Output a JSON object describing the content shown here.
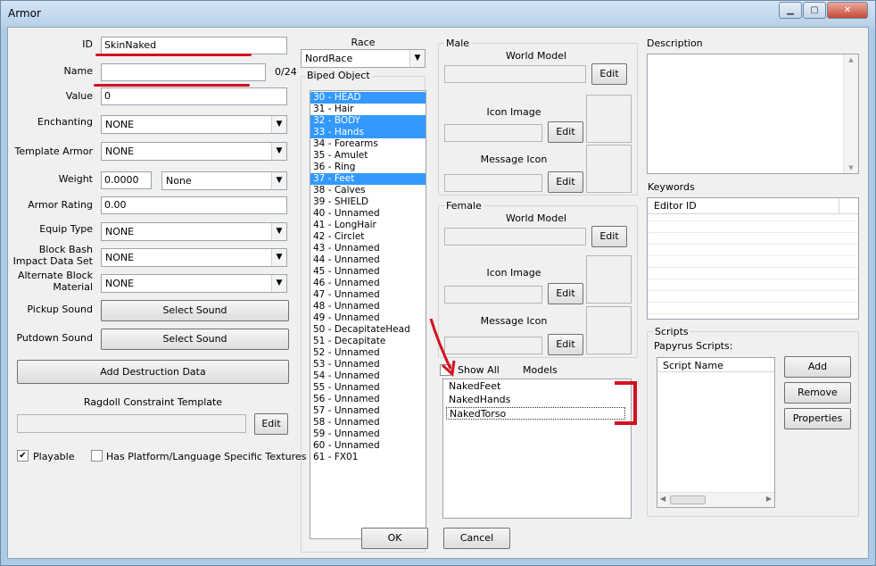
{
  "window": {
    "title": "Armor"
  },
  "form": {
    "id_label": "ID",
    "id_value": "SkinNaked",
    "name_label": "Name",
    "name_value": "",
    "name_counter": "0/24",
    "value_label": "Value",
    "value_value": "0",
    "enchanting_label": "Enchanting",
    "enchanting_value": "NONE",
    "template_label": "Template Armor",
    "template_value": "NONE",
    "weight_label": "Weight",
    "weight_value": "0.0000",
    "weight_type": "None",
    "armor_rating_label": "Armor Rating",
    "armor_rating_value": "0.00",
    "equip_type_label": "Equip Type",
    "equip_type_value": "NONE",
    "block_bash_label_1": "Block Bash",
    "block_bash_label_2": "Impact Data Set",
    "block_bash_value": "NONE",
    "alt_block_label_1": "Alternate Block",
    "alt_block_label_2": "Material",
    "alt_block_value": "NONE",
    "pickup_label": "Pickup Sound",
    "pickup_button": "Select Sound",
    "putdown_label": "Putdown Sound",
    "putdown_button": "Select Sound",
    "destruction_button": "Add Destruction Data",
    "ragdoll_label": "Ragdoll Constraint Template",
    "ragdoll_edit": "Edit",
    "playable_label": "Playable",
    "playable_checked": true,
    "platform_label": "Has Platform/Language Specific Textures",
    "platform_checked": false
  },
  "race": {
    "label": "Race",
    "value": "NordRace"
  },
  "biped": {
    "label": "Biped Object",
    "items": [
      {
        "text": "30 - HEAD",
        "selected": true
      },
      {
        "text": "31 - Hair",
        "selected": false
      },
      {
        "text": "32 - BODY",
        "selected": true
      },
      {
        "text": "33 - Hands",
        "selected": true
      },
      {
        "text": "34 - Forearms",
        "selected": false
      },
      {
        "text": "35 - Amulet",
        "selected": false
      },
      {
        "text": "36 - Ring",
        "selected": false
      },
      {
        "text": "37 - Feet",
        "selected": true
      },
      {
        "text": "38 - Calves",
        "selected": false
      },
      {
        "text": "39 - SHIELD",
        "selected": false
      },
      {
        "text": "40 - Unnamed",
        "selected": false
      },
      {
        "text": "41 - LongHair",
        "selected": false
      },
      {
        "text": "42 - Circlet",
        "selected": false
      },
      {
        "text": "43 - Unnamed",
        "selected": false
      },
      {
        "text": "44 - Unnamed",
        "selected": false
      },
      {
        "text": "45 - Unnamed",
        "selected": false
      },
      {
        "text": "46 - Unnamed",
        "selected": false
      },
      {
        "text": "47 - Unnamed",
        "selected": false
      },
      {
        "text": "48 - Unnamed",
        "selected": false
      },
      {
        "text": "49 - Unnamed",
        "selected": false
      },
      {
        "text": "50 - DecapitateHead",
        "selected": false
      },
      {
        "text": "51 - Decapitate",
        "selected": false
      },
      {
        "text": "52 - Unnamed",
        "selected": false
      },
      {
        "text": "53 - Unnamed",
        "selected": false
      },
      {
        "text": "54 - Unnamed",
        "selected": false
      },
      {
        "text": "55 - Unnamed",
        "selected": false
      },
      {
        "text": "56 - Unnamed",
        "selected": false
      },
      {
        "text": "57 - Unnamed",
        "selected": false
      },
      {
        "text": "58 - Unnamed",
        "selected": false
      },
      {
        "text": "59 - Unnamed",
        "selected": false
      },
      {
        "text": "60 - Unnamed",
        "selected": false
      },
      {
        "text": "61 - FX01",
        "selected": false
      }
    ]
  },
  "male": {
    "label": "Male",
    "world_model": "World Model",
    "icon_image": "Icon Image",
    "message_icon": "Message Icon",
    "edit": "Edit"
  },
  "female": {
    "label": "Female",
    "world_model": "World Model",
    "icon_image": "Icon Image",
    "message_icon": "Message Icon",
    "edit": "Edit"
  },
  "models": {
    "show_all": "Show All",
    "label": "Models",
    "items": [
      "NakedFeet",
      "NakedHands",
      "NakedTorso"
    ]
  },
  "description": {
    "label": "Description"
  },
  "keywords": {
    "label": "Keywords",
    "column": "Editor ID"
  },
  "scripts": {
    "group": "Scripts",
    "papyrus": "Papyrus Scripts:",
    "column": "Script Name",
    "add": "Add",
    "remove": "Remove",
    "properties": "Properties"
  },
  "buttons": {
    "ok": "OK",
    "cancel": "Cancel"
  },
  "colors": {
    "selection": "#3399ff",
    "annotation": "#d41020"
  }
}
